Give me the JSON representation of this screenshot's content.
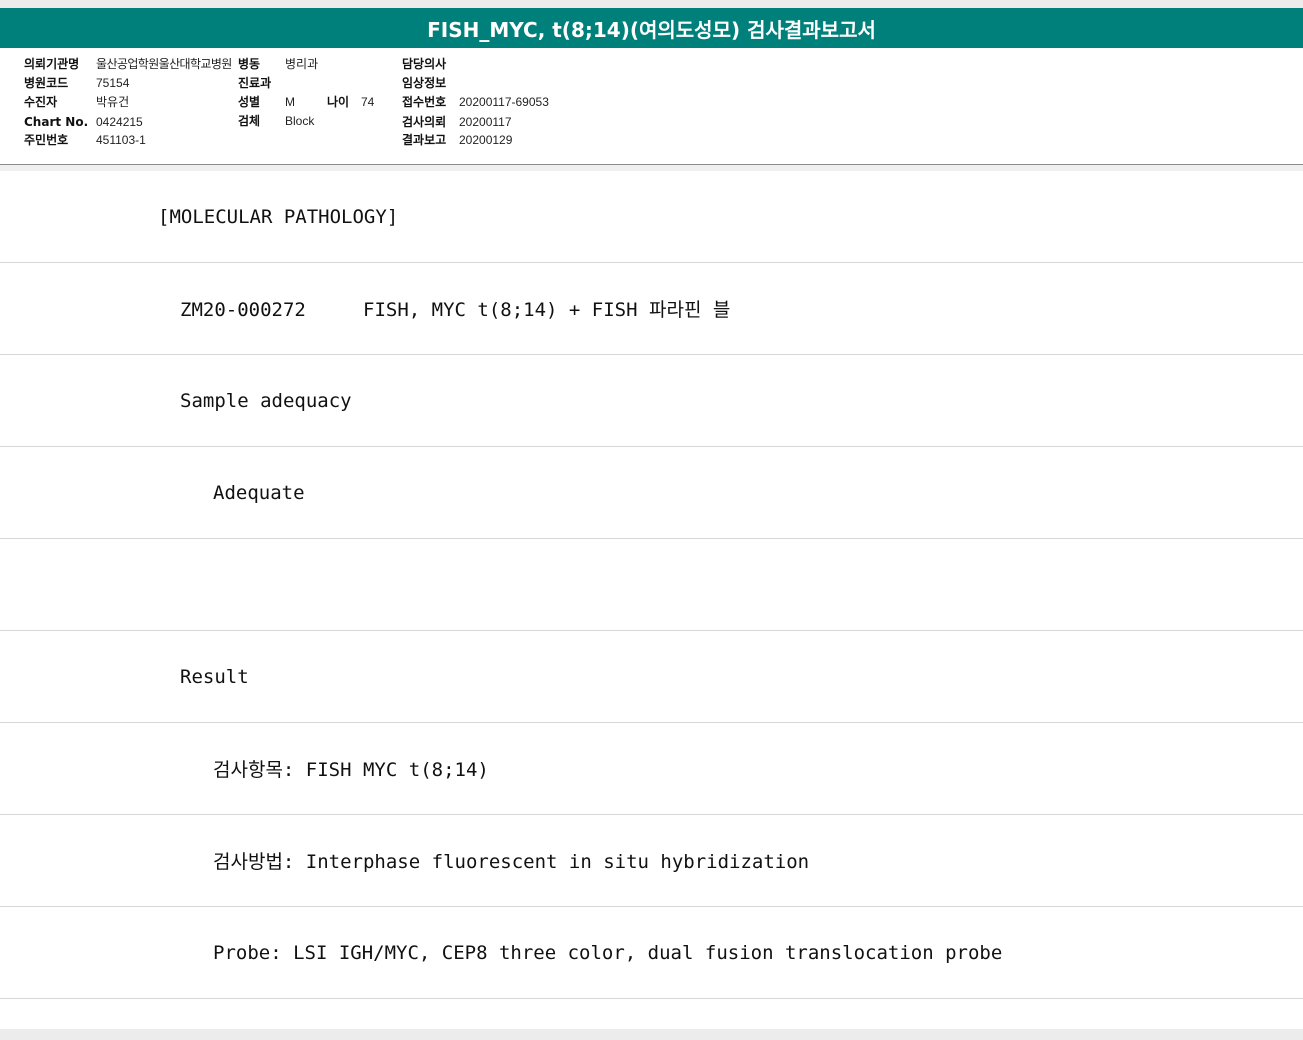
{
  "header": {
    "title": "FISH_MYC, t(8;14)(여의도성모) 검사결과보고서"
  },
  "info": {
    "requesting_org_label": "의뢰기관명",
    "requesting_org_value": "울산공업학원울산대학교병원",
    "ward_label": "병동",
    "ward_value": "병리과",
    "doctor_label": "담당의사",
    "doctor_value": "",
    "hospital_code_label": "병원코드",
    "hospital_code_value": "75154",
    "department_label": "진료과",
    "department_value": "",
    "clinical_info_label": "임상정보",
    "clinical_info_value": "",
    "patient_label": "수진자",
    "patient_value": "박유건",
    "sex_label": "성별",
    "sex_value": "M",
    "age_label": "나이",
    "age_value": "74",
    "receipt_no_label": "접수번호",
    "receipt_no_value": "20200117-69053",
    "chart_no_label": "Chart No.",
    "chart_no_value": "0424215",
    "specimen_label": "검체",
    "specimen_value": "Block",
    "request_date_label": "검사의뢰",
    "request_date_value": "20200117",
    "resident_no_label": "주민번호",
    "resident_no_value": "451103-1",
    "report_date_label": "결과보고",
    "report_date_value": "20200129"
  },
  "report": {
    "lines": [
      "[MOLECULAR PATHOLOGY]",
      "ZM20-000272     FISH, MYC t(8;14) + FISH 파라핀 블",
      "Sample adequacy",
      "Adequate",
      "",
      "Result",
      "검사항목: FISH MYC t(8;14)",
      "검사방법: Interphase fluorescent in situ hybridization",
      "Probe: LSI IGH/MYC, CEP8 three color, dual fusion translocation probe"
    ]
  }
}
